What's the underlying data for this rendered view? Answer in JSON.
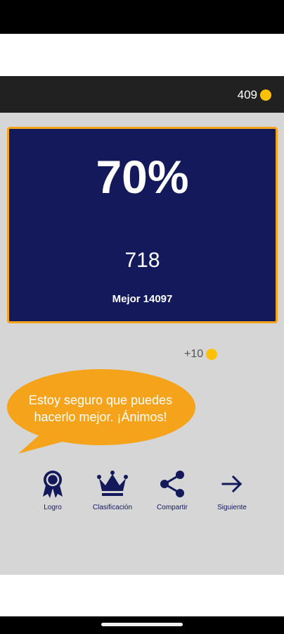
{
  "header": {
    "coin_count": "409",
    "coin_color": "#ffc107"
  },
  "result": {
    "percent": "70%",
    "score": "718",
    "best_label": "Mejor",
    "best_value": "14097"
  },
  "bonus": {
    "text": "+10"
  },
  "bubble": {
    "line1": "Estoy seguro que puedes",
    "line2": "hacerlo mejor. ¡Ánimos!",
    "color": "#f5a31a"
  },
  "actions": [
    {
      "label": "Logro",
      "icon": "award-ribbon-icon"
    },
    {
      "label": "Clasificación",
      "icon": "crown-icon"
    },
    {
      "label": "Compartir",
      "icon": "share-icon"
    },
    {
      "label": "Siguiente",
      "icon": "arrow-right-icon"
    }
  ],
  "colors": {
    "card_background": "#13195a",
    "card_border": "#f5a31a",
    "content_background": "#d6d6d6",
    "app_bar": "#212121"
  }
}
